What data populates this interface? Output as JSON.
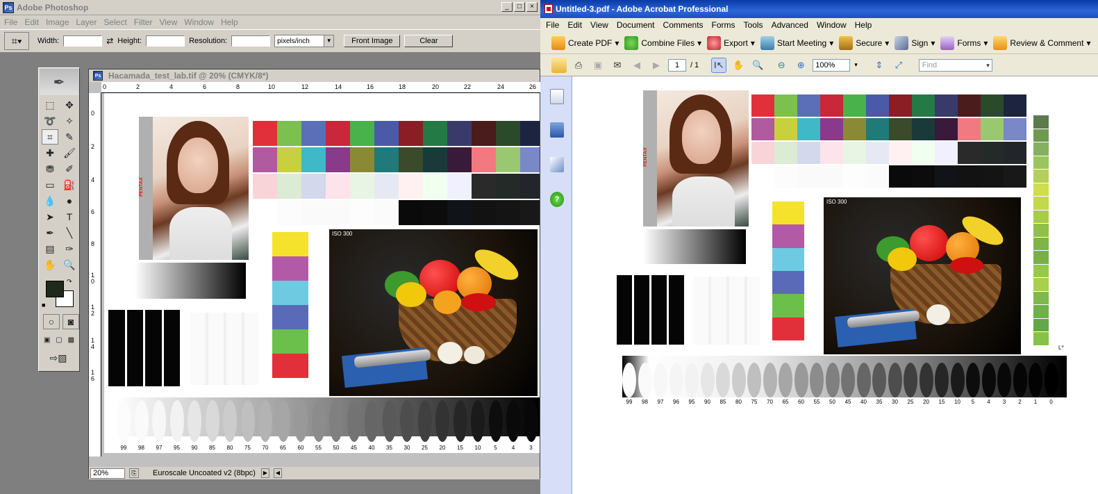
{
  "photoshop": {
    "title": "Adobe Photoshop",
    "menu": [
      "File",
      "Edit",
      "Image",
      "Layer",
      "Select",
      "Filter",
      "View",
      "Window",
      "Help"
    ],
    "options": {
      "width_label": "Width:",
      "height_label": "Height:",
      "resolution_label": "Resolution:",
      "units": "pixels/inch",
      "front_image": "Front Image",
      "clear": "Clear"
    },
    "document": {
      "title": "Hacamada_test_lab.tif @ 20% (CMYK/8*)",
      "ruler_h": [
        "0",
        "2",
        "4",
        "6",
        "8",
        "10",
        "12",
        "14",
        "16",
        "18",
        "20",
        "22",
        "24",
        "26"
      ],
      "ruler_v": [
        "0",
        "2",
        "4",
        "6",
        "8",
        "1\n0",
        "1\n2",
        "1\n4",
        "1\n6"
      ],
      "zoom": "20%",
      "profile": "Euroscale Uncoated v2 (8bpc)",
      "iso": "ISO 300",
      "pentax": "PENTAX",
      "oval_labels": [
        "99",
        "98",
        "97",
        "95",
        "90",
        "85",
        "80",
        "75",
        "70",
        "65",
        "60",
        "55",
        "50",
        "45",
        "40",
        "35",
        "30",
        "25",
        "20",
        "15",
        "10",
        "5",
        "4",
        "3"
      ]
    }
  },
  "acrobat": {
    "title": "Untitled-3.pdf - Adobe Acrobat Professional",
    "menu": [
      "File",
      "Edit",
      "View",
      "Document",
      "Comments",
      "Forms",
      "Tools",
      "Advanced",
      "Window",
      "Help"
    ],
    "toolbar": {
      "create_pdf": "Create PDF",
      "combine_files": "Combine Files",
      "export": "Export",
      "start_meeting": "Start Meeting",
      "secure": "Secure",
      "sign": "Sign",
      "forms": "Forms",
      "review": "Review & Comment"
    },
    "nav": {
      "page": "1",
      "page_total": "/ 1",
      "zoom": "100%",
      "find_placeholder": "Find"
    },
    "page": {
      "iso": "ISO 300",
      "pentax": "PENTAX",
      "corner_mark": "L*",
      "oval_labels": [
        "99",
        "98",
        "97",
        "96",
        "95",
        "90",
        "85",
        "80",
        "75",
        "70",
        "65",
        "60",
        "55",
        "50",
        "45",
        "40",
        "35",
        "30",
        "25",
        "20",
        "15",
        "10",
        "5",
        "4",
        "3",
        "2",
        "1",
        "0"
      ]
    }
  },
  "colors": {
    "xp_blue": "#0a3aa6",
    "win_gray": "#d4d0c8",
    "xp_beige": "#ece9d8"
  }
}
